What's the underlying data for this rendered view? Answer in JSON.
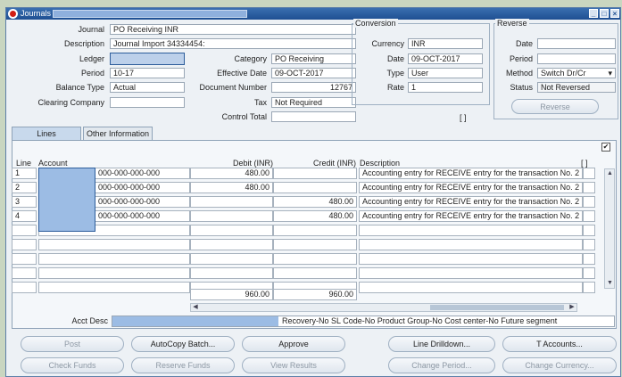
{
  "window": {
    "title": "Journals"
  },
  "header": {
    "journal_label": "Journal",
    "journal": "PO Receiving INR",
    "description_label": "Description",
    "description": "Journal Import 34334454:",
    "ledger_label": "Ledger",
    "ledger": "",
    "period_label": "Period",
    "period": "10-17",
    "balance_type_label": "Balance Type",
    "balance_type": "Actual",
    "clearing_company_label": "Clearing Company",
    "clearing_company": "",
    "category_label": "Category",
    "category": "PO Receiving",
    "effective_date_label": "Effective Date",
    "effective_date": "09-OCT-2017",
    "document_number_label": "Document Number",
    "document_number": "12767",
    "tax_label": "Tax",
    "tax": "Not Required",
    "control_total_label": "Control Total",
    "control_total": ""
  },
  "conversion": {
    "title": "Conversion",
    "currency_label": "Currency",
    "currency": "INR",
    "date_label": "Date",
    "date": "09-OCT-2017",
    "type_label": "Type",
    "type": "User",
    "rate_label": "Rate",
    "rate": "1"
  },
  "reverse": {
    "title": "Reverse",
    "date_label": "Date",
    "date": "",
    "period_label": "Period",
    "period": "",
    "method_label": "Method",
    "method": "Switch Dr/Cr",
    "status_label": "Status",
    "status": "Not Reversed",
    "button": "Reverse"
  },
  "misc": {
    "bracket_marker": "[ ]"
  },
  "tabs": [
    {
      "label": "Lines"
    },
    {
      "label": "Other Information"
    }
  ],
  "lines": {
    "headers": {
      "line": "Line",
      "account": "Account",
      "debit": "Debit (INR)",
      "credit": "Credit (INR)",
      "description": "Description",
      "flag": "[ ]"
    },
    "rows": [
      {
        "line": "1",
        "account": "000-000-000-000",
        "debit": "480.00",
        "credit": "",
        "description": "Accounting entry for RECEIVE entry for the transaction No. 2"
      },
      {
        "line": "2",
        "account": "000-000-000-000",
        "debit": "480.00",
        "credit": "",
        "description": "Accounting entry for RECEIVE entry for the transaction No. 2"
      },
      {
        "line": "3",
        "account": "000-000-000-000",
        "debit": "",
        "credit": "480.00",
        "description": "Accounting entry for RECEIVE entry for the transaction No. 2"
      },
      {
        "line": "4",
        "account": "000-000-000-000",
        "debit": "",
        "credit": "480.00",
        "description": "Accounting entry for RECEIVE entry for the transaction No. 2"
      }
    ],
    "total_debit": "960.00",
    "total_credit": "960.00"
  },
  "acct_desc": {
    "label": "Acct Desc",
    "value": "Recovery-No SL Code-No Product Group-No Cost center-No Future segment"
  },
  "buttons": {
    "row1": [
      "Post",
      "AutoCopy Batch...",
      "Approve",
      "Line Drilldown...",
      "T Accounts..."
    ],
    "row2": [
      "Check Funds",
      "Reserve Funds",
      "View Results",
      "Change Period...",
      "Change Currency..."
    ]
  },
  "colors": {
    "titlebar": "#1f4f92",
    "selection": "#9cbce4",
    "panel": "#edf1f5"
  }
}
